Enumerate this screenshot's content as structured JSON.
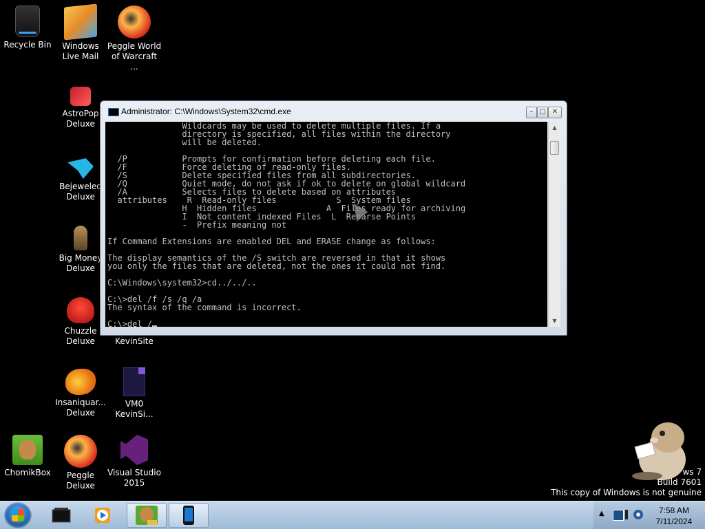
{
  "desktop": {
    "icons": [
      {
        "label": "Recycle Bin"
      },
      {
        "label": "Windows Live Mail"
      },
      {
        "label": "Peggle World of Warcraft ..."
      },
      {
        "label": "AstroPop Deluxe"
      },
      {
        "label": "Bejeweled Deluxe"
      },
      {
        "label": "Big Money Deluxe"
      },
      {
        "label": "Chuzzle Deluxe"
      },
      {
        "label": "KevinSite"
      },
      {
        "label": "Insaniquar... Deluxe"
      },
      {
        "label": "VM0 KevinSi..."
      },
      {
        "label": "ChomikBox"
      },
      {
        "label": "Peggle Deluxe"
      },
      {
        "label": "Visual Studio 2015"
      }
    ]
  },
  "cmd": {
    "title": "Administrator: C:\\Windows\\System32\\cmd.exe",
    "console_text": "               Wildcards may be used to delete multiple files. If a\n               directory is specified, all files within the directory\n               will be deleted.\n\n  /P           Prompts for confirmation before deleting each file.\n  /F           Force deleting of read-only files.\n  /S           Delete specified files from all subdirectories.\n  /Q           Quiet mode, do not ask if ok to delete on global wildcard\n  /A           Selects files to delete based on attributes\n  attributes    R  Read-only files            S  System files\n               H  Hidden files              A  Files ready for archiving\n               I  Not content indexed Files  L  Reparse Points\n               -  Prefix meaning not\n\nIf Command Extensions are enabled DEL and ERASE change as follows:\n\nThe display semantics of the /S switch are reversed in that it shows\nyou only the files that are deleted, not the ones it could not find.\n\nC:\\Windows\\system32>cd../../..\n\nC:\\>del /f /s /q /a\nThe syntax of the command is incorrect.\n\nC:\\>del /",
    "buttons": {
      "minimize": "–",
      "maximize": "□",
      "close": "✕"
    }
  },
  "watermark": {
    "line1": "ws 7",
    "line2": "Build 7601",
    "line3": "This copy of Windows is not genuine"
  },
  "taskbar": {
    "items": [
      "start-button",
      "command-prompt",
      "media-player",
      "chomikbox",
      "device"
    ],
    "clock_time": "7:58 AM",
    "clock_date": "7/11/2024"
  }
}
